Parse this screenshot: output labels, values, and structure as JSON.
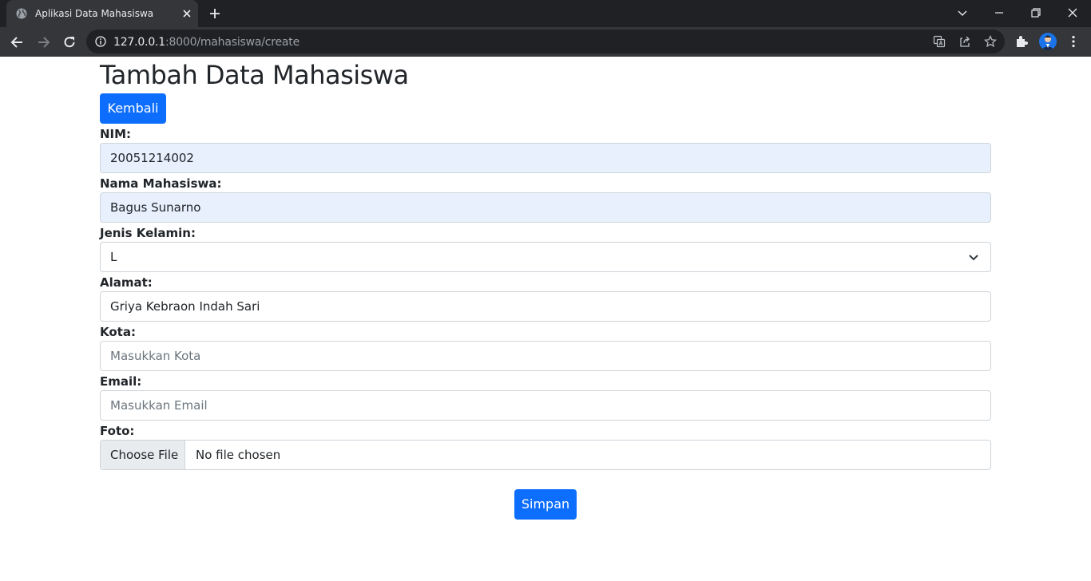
{
  "browser": {
    "tab_title": "Aplikasi Data Mahasiswa",
    "url_host": "127.0.0.1",
    "url_path": ":8000/mahasiswa/create"
  },
  "page": {
    "title": "Tambah Data Mahasiswa",
    "back_button": "Kembali",
    "submit_button": "Simpan"
  },
  "form": {
    "nim": {
      "label": "NIM:",
      "value": "20051214002"
    },
    "nama": {
      "label": "Nama Mahasiswa:",
      "value": "Bagus Sunarno"
    },
    "jenis_kelamin": {
      "label": "Jenis Kelamin:",
      "value": "L"
    },
    "alamat": {
      "label": "Alamat:",
      "value": "Griya Kebraon Indah Sari"
    },
    "kota": {
      "label": "Kota:",
      "placeholder": "Masukkan Kota"
    },
    "email": {
      "label": "Email:",
      "placeholder": "Masukkan Email"
    },
    "foto": {
      "label": "Foto:",
      "button": "Choose File",
      "status": "No file chosen"
    }
  },
  "colors": {
    "primary": "#0d6efd",
    "autofill": "#e8f0fe",
    "chrome_dark": "#202124",
    "chrome_toolbar": "#35363a"
  }
}
